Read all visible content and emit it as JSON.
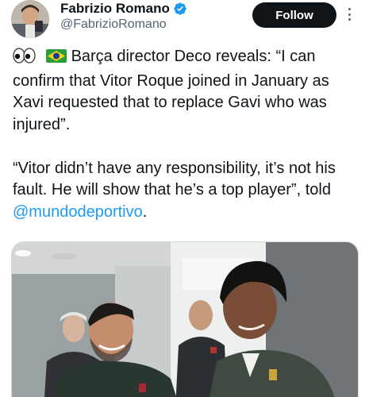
{
  "author": {
    "display_name": "Fabrizio Romano",
    "handle": "@FabrizioRomano",
    "verified": true,
    "avatar_icon": "profile-photo"
  },
  "actions": {
    "follow_label": "Follow",
    "more_icon": "more-vertical-icon"
  },
  "tweet": {
    "line1_emojis": "👀🇧🇷",
    "paragraph1": "Barça director Deco reveals: “I can confirm that Vitor Roque joined in January as Xavi requested that to replace Gavi who was injured”.",
    "paragraph2_start": "“Vitor didn’t have any responsibility, it’s not his fault. He will show that he’s a top player”, told ",
    "mention": "@mundodeportivo",
    "paragraph2_end": "."
  },
  "media": {
    "type": "photo",
    "description_icon": "photo-icon"
  },
  "colors": {
    "text": "#0f1419",
    "secondary": "#536471",
    "link": "#1d9bf0",
    "button_bg": "#0f1419",
    "verified": "#1d9bf0"
  }
}
